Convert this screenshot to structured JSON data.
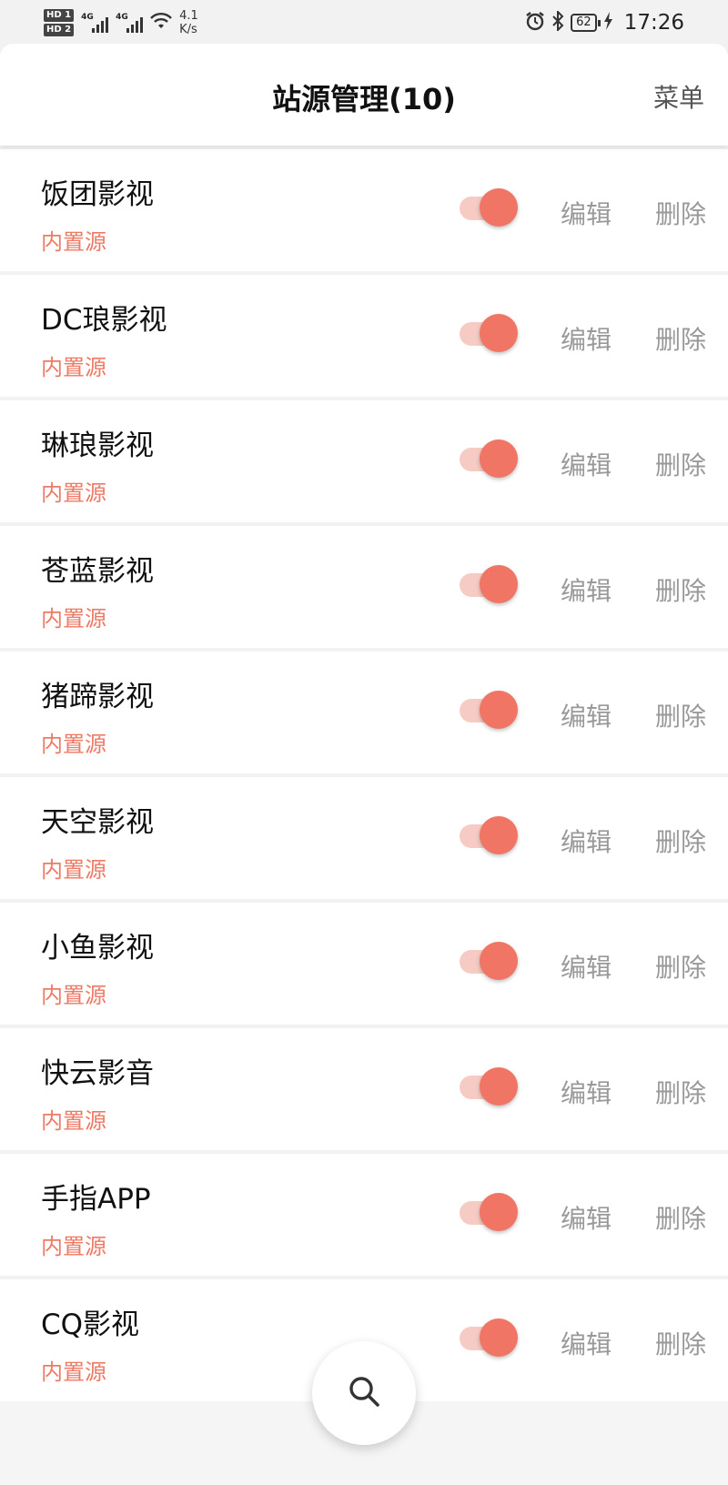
{
  "status_bar": {
    "hd1": "HD 1",
    "hd2": "HD 2",
    "net1": "4G",
    "net2": "4G",
    "speed_value": "4.1",
    "speed_unit": "K/s",
    "battery": "62",
    "time": "17:26"
  },
  "header": {
    "title": "站源管理(10)",
    "menu_label": "菜单"
  },
  "sources": [
    {
      "name": "饭团影视",
      "tag": "内置源",
      "enabled": true
    },
    {
      "name": "DC琅影视",
      "tag": "内置源",
      "enabled": true
    },
    {
      "name": "琳琅影视",
      "tag": "内置源",
      "enabled": true
    },
    {
      "name": "苍蓝影视",
      "tag": "内置源",
      "enabled": true
    },
    {
      "name": "猪蹄影视",
      "tag": "内置源",
      "enabled": true
    },
    {
      "name": "天空影视",
      "tag": "内置源",
      "enabled": true
    },
    {
      "name": "小鱼影视",
      "tag": "内置源",
      "enabled": true
    },
    {
      "name": "快云影音",
      "tag": "内置源",
      "enabled": true
    },
    {
      "name": "手指APP",
      "tag": "内置源",
      "enabled": true
    },
    {
      "name": "CQ影视",
      "tag": "内置源",
      "enabled": true
    }
  ],
  "actions": {
    "edit_label": "编辑",
    "delete_label": "删除"
  },
  "fab": {
    "icon": "search-icon"
  },
  "colors": {
    "accent": "#f07564",
    "accent_light": "#f6cbc3",
    "tag": "#ee7a66",
    "action_text": "#999999"
  }
}
